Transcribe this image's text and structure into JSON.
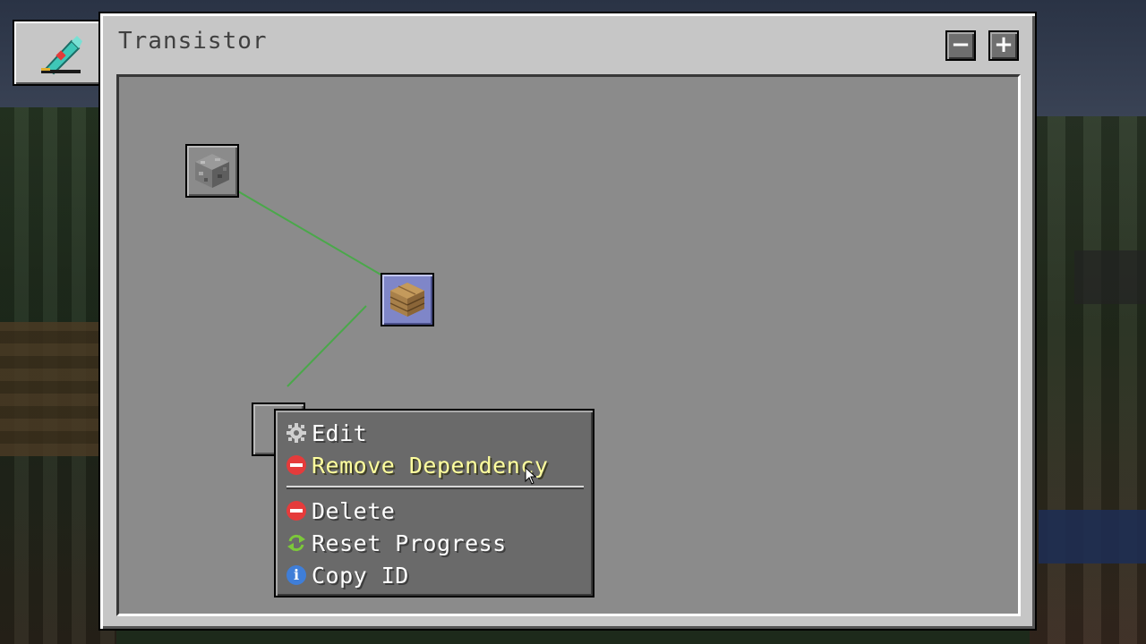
{
  "window": {
    "title": "Transistor",
    "zoom_out_label": "−",
    "zoom_in_label": "+"
  },
  "tab": {
    "icon": "quest-book-icon"
  },
  "nodes": [
    {
      "name": "cobblestone-quest-node",
      "icon": "cobblestone-block-icon",
      "selected": false
    },
    {
      "name": "oak-planks-quest-node",
      "icon": "oak-planks-block-icon",
      "selected": true
    },
    {
      "name": "blank-quest-node",
      "icon": "",
      "selected": false
    }
  ],
  "context_menu": {
    "items": [
      {
        "label": "Edit",
        "icon": "gear-icon"
      },
      {
        "label": "Remove Dependency",
        "icon": "remove-icon",
        "hovered": true
      },
      {
        "label": "Delete",
        "icon": "remove-icon"
      },
      {
        "label": "Reset Progress",
        "icon": "refresh-arrows-icon"
      },
      {
        "label": "Copy ID",
        "icon": "info-icon"
      }
    ]
  },
  "colors": {
    "dependency_line": "#4aa84a",
    "selected_node": "#7f86c8",
    "hover_text": "#ffff9e"
  }
}
